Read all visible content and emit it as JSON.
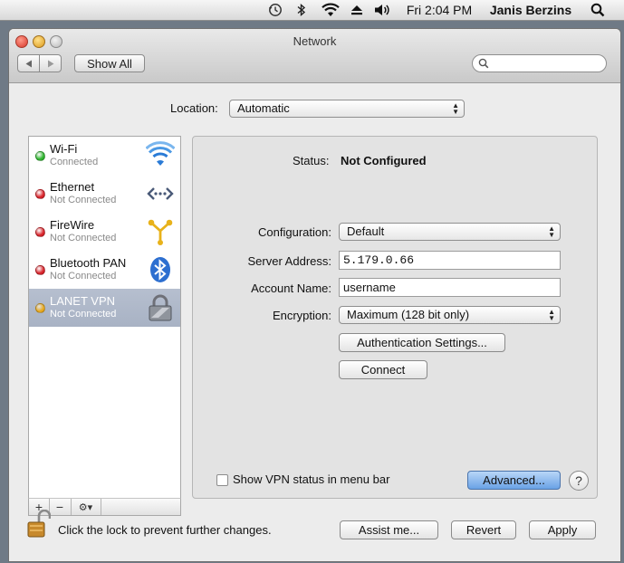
{
  "menubar": {
    "clock": "Fri 2:04 PM",
    "user": "Janis Berzins"
  },
  "window": {
    "title": "Network",
    "show_all_label": "Show All",
    "search_placeholder": ""
  },
  "location": {
    "label": "Location:",
    "value": "Automatic"
  },
  "services": [
    {
      "name": "Wi-Fi",
      "status": "Connected",
      "dot_color": "#2fb52f",
      "icon": "wifi-icon",
      "selected": false
    },
    {
      "name": "Ethernet",
      "status": "Not Connected",
      "dot_color": "#d8232a",
      "icon": "ethernet-icon",
      "selected": false
    },
    {
      "name": "FireWire",
      "status": "Not Connected",
      "dot_color": "#d8232a",
      "icon": "firewire-icon",
      "selected": false
    },
    {
      "name": "Bluetooth PAN",
      "status": "Not Connected",
      "dot_color": "#d8232a",
      "icon": "bluetooth-icon",
      "selected": false
    },
    {
      "name": "LANET VPN",
      "status": "Not Connected",
      "dot_color": "#e8a81c",
      "icon": "vpn-lock-icon",
      "selected": true
    }
  ],
  "sidebar_tools": {
    "add": "+",
    "remove": "−",
    "gear": "⚙▾"
  },
  "detail": {
    "status_label": "Status:",
    "status_value": "Not Configured",
    "configuration_label": "Configuration:",
    "configuration_value": "Default",
    "server_label": "Server Address:",
    "server_value": "5.179.0.66",
    "account_label": "Account Name:",
    "account_value": "username",
    "encryption_label": "Encryption:",
    "encryption_value": "Maximum (128 bit only)",
    "auth_button": "Authentication Settings...",
    "connect_button": "Connect",
    "show_vpn_label": "Show VPN status in menu bar",
    "show_vpn_checked": false,
    "advanced_button": "Advanced...",
    "help_label": "?"
  },
  "footer": {
    "lock_text": "Click the lock to prevent further changes.",
    "assist_button": "Assist me...",
    "revert_button": "Revert",
    "apply_button": "Apply"
  },
  "colors": {
    "accent_blue": "#6aa2e6",
    "selection": "#a8b2c4"
  }
}
